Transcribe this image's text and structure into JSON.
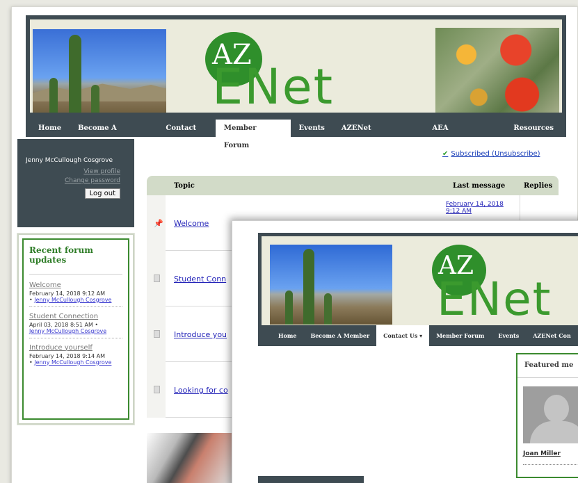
{
  "site": {
    "logo_top": "AZ",
    "logo_bottom": "ENet"
  },
  "nav": {
    "items": [
      "Home",
      "Become A Member",
      "Contact Us",
      "Member Forum",
      "Events",
      "AZENet Conference",
      "AEA Conferences",
      "Resources"
    ],
    "active": "Member Forum"
  },
  "login": {
    "name": "Jenny McCullough Cosgrove",
    "view_profile": "View profile",
    "change_password": "Change password",
    "logout": "Log out"
  },
  "recent": {
    "title": "Recent forum updates",
    "items": [
      {
        "topic": "Welcome",
        "date": "February 14, 2018 9:12 AM",
        "user": "Jenny McCullough Cosgrove"
      },
      {
        "topic": "Student Connection",
        "date": "April 03, 2018 8:51 AM",
        "user": "Jenny McCullough Cosgrove"
      },
      {
        "topic": "Introduce yourself",
        "date": "February 14, 2018 9:14 AM",
        "user": "Jenny McCullough Cosgrove"
      }
    ]
  },
  "forum": {
    "subscribed": "Subscribed (Unsubscribe)",
    "col_topic": "Topic",
    "col_last": "Last message",
    "col_replies": "Replies",
    "rows": [
      {
        "topic": "Welcome",
        "last": "February 14, 2018 9:12 AM"
      },
      {
        "topic": "Student Conn",
        "last": ""
      },
      {
        "topic": "Introduce you",
        "last": ""
      },
      {
        "topic": "Looking for co",
        "last": ""
      }
    ]
  },
  "front": {
    "nav": [
      "Home",
      "Become A Member",
      "Contact Us ▾",
      "Member Forum",
      "Events",
      "AZENet Con"
    ],
    "active": "Contact Us ▾",
    "featured_title": "Featured me",
    "featured_name": "Joan Miller"
  }
}
